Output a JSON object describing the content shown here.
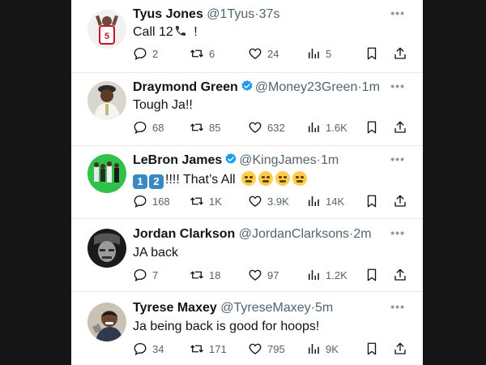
{
  "tweets": [
    {
      "name": "Tyus Jones",
      "handle": "@1Tyus",
      "time": "37s",
      "verified": false,
      "text_before": "Call 12",
      "text_after": " !",
      "replies": "2",
      "retweets": "6",
      "likes": "24",
      "views": "5",
      "avatar_icon": "basketball-player-avatar"
    },
    {
      "name": "Draymond Green",
      "handle": "@Money23Green",
      "time": "1m",
      "verified": true,
      "text": "Tough Ja!!",
      "replies": "68",
      "retweets": "85",
      "likes": "632",
      "views": "1.6K",
      "avatar_icon": "person-avatar"
    },
    {
      "name": "LeBron James",
      "handle": "@KingJames",
      "time": "1m",
      "verified": true,
      "key1": "1",
      "key2": "2",
      "text": "!!!! That’s All",
      "replies": "168",
      "retweets": "1K",
      "likes": "3.9K",
      "views": "14K",
      "avatar_icon": "group-photo-avatar"
    },
    {
      "name": "Jordan Clarkson",
      "handle": "@JordanClarksons",
      "time": "2m",
      "verified": false,
      "text": "JA back",
      "replies": "7",
      "retweets": "18",
      "likes": "97",
      "views": "1.2K",
      "avatar_icon": "bw-portrait-avatar"
    },
    {
      "name": "Tyrese Maxey",
      "handle": "@TyreseMaxey",
      "time": "5m",
      "verified": false,
      "text": "Ja being back is good for hoops!",
      "replies": "34",
      "retweets": "171",
      "likes": "795",
      "views": "9K",
      "avatar_icon": "smiling-person-avatar"
    }
  ],
  "separator": "·",
  "colors": {
    "verified": "#1d9bf0",
    "muted": "#536471",
    "text": "#0f1419"
  }
}
